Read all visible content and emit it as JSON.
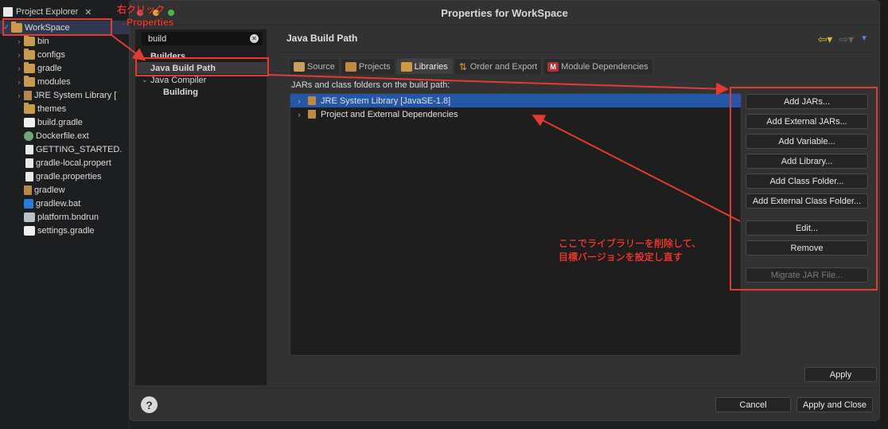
{
  "explorer": {
    "tab_label": "Project Explorer",
    "items": [
      {
        "label": "WorkSpace",
        "kind": "project",
        "indent": 0,
        "twisty": "✓"
      },
      {
        "label": "bin",
        "kind": "folder",
        "twisty": "›"
      },
      {
        "label": "configs",
        "kind": "folder",
        "twisty": "›"
      },
      {
        "label": "gradle",
        "kind": "folder",
        "twisty": "›"
      },
      {
        "label": "modules",
        "kind": "folder",
        "twisty": "›"
      },
      {
        "label": "JRE System Library [",
        "kind": "lib",
        "twisty": "›"
      },
      {
        "label": "themes",
        "kind": "folder",
        "twisty": ""
      },
      {
        "label": "build.gradle",
        "kind": "gradle",
        "twisty": ""
      },
      {
        "label": "Dockerfile.ext",
        "kind": "docker",
        "twisty": ""
      },
      {
        "label": "GETTING_STARTED.",
        "kind": "file",
        "twisty": ""
      },
      {
        "label": "gradle-local.propert",
        "kind": "file",
        "twisty": ""
      },
      {
        "label": "gradle.properties",
        "kind": "file",
        "twisty": ""
      },
      {
        "label": "gradlew",
        "kind": "lib",
        "twisty": ""
      },
      {
        "label": "gradlew.bat",
        "kind": "vsc",
        "twisty": ""
      },
      {
        "label": "platform.bndrun",
        "kind": "platform",
        "twisty": ""
      },
      {
        "label": "settings.gradle",
        "kind": "gradle",
        "twisty": ""
      }
    ]
  },
  "dialog": {
    "title": "Properties for WorkSpace",
    "filter_value": "build",
    "nav": {
      "builders": "Builders",
      "java_build_path": "Java Build Path",
      "java_compiler": "Java Compiler",
      "building": "Building"
    },
    "heading": "Java Build Path",
    "tabs": [
      {
        "label": "Source",
        "icon": "source-folder-icon"
      },
      {
        "label": "Projects",
        "icon": "projects-icon"
      },
      {
        "label": "Libraries",
        "icon": "libraries-icon"
      },
      {
        "label": "Order and Export",
        "icon": "order-icon"
      },
      {
        "label": "Module Dependencies",
        "icon": "module-icon",
        "badge": "M"
      }
    ],
    "pane_label": "JARs and class folders on the build path:",
    "libraries": [
      {
        "label": "JRE System Library [JavaSE-1.8]",
        "selected": true
      },
      {
        "label": "Project and External Dependencies",
        "selected": false
      }
    ],
    "buttons": {
      "add_jars": "Add JARs...",
      "add_external_jars": "Add External JARs...",
      "add_variable": "Add Variable...",
      "add_library": "Add Library...",
      "add_class_folder": "Add Class Folder...",
      "add_external_class_folder": "Add External Class Folder...",
      "edit": "Edit...",
      "remove": "Remove",
      "migrate_jar": "Migrate JAR File..."
    },
    "apply": "Apply",
    "cancel": "Cancel",
    "apply_and_close": "Apply and Close",
    "help": "?"
  },
  "annotations": {
    "right_click": "右クリック",
    "properties": "→Properties",
    "note_line1": "ここでライブラリーを削除して、",
    "note_line2": "目標バージョンを設定し直す"
  },
  "colors": {
    "annotation_red": "#e43a2f",
    "selection_blue": "#2457a8"
  }
}
